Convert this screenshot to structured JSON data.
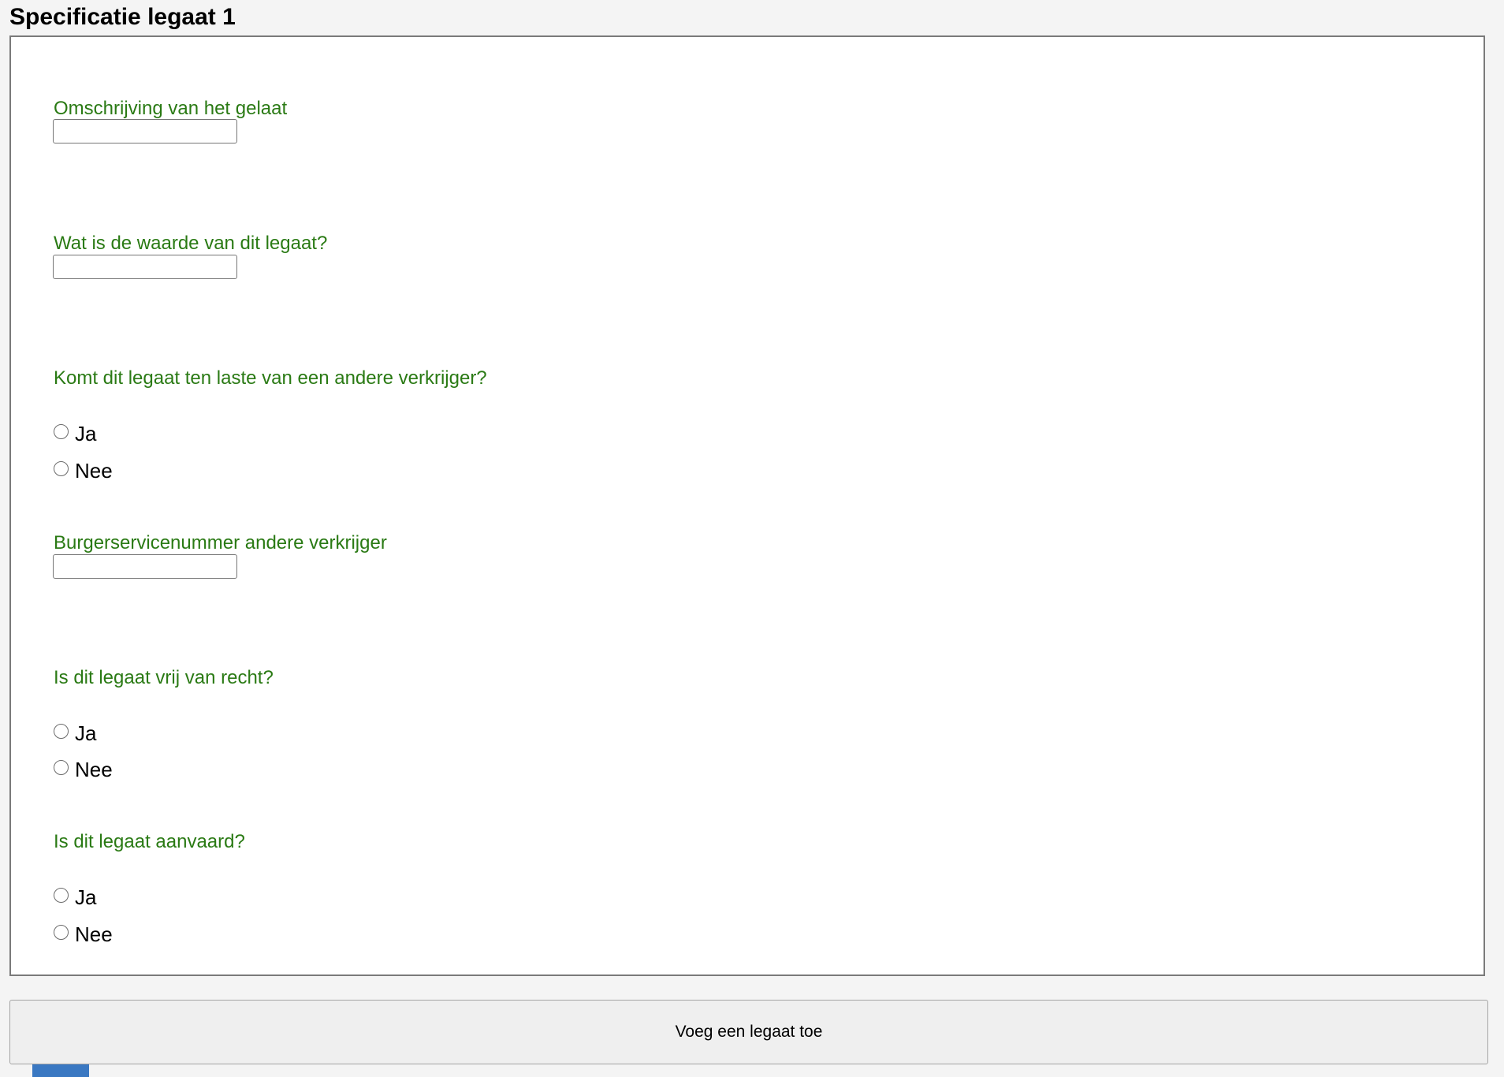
{
  "section": {
    "title": "Specificatie legaat 1"
  },
  "form": {
    "q1": {
      "label": "Omschrijving van het gelaat",
      "value": ""
    },
    "q2": {
      "label": "Wat is de waarde van dit legaat?",
      "value": ""
    },
    "q3": {
      "label": "Komt dit legaat ten laste van een andere verkrijger?",
      "options": [
        "Ja",
        "Nee"
      ],
      "selected": null
    },
    "q4": {
      "label": "Burgerservicenummer andere verkrijger",
      "value": ""
    },
    "q5": {
      "label": "Is dit legaat vrij van recht?",
      "options": [
        "Ja",
        "Nee"
      ],
      "selected": null
    },
    "q6": {
      "label": "Is dit legaat aanvaard?",
      "options": [
        "Ja",
        "Nee"
      ],
      "selected": null
    }
  },
  "actions": {
    "add_label": "Voeg een legaat toe"
  },
  "colors": {
    "question_text": "#2a7a14",
    "tab_accent": "#3a78c2"
  }
}
